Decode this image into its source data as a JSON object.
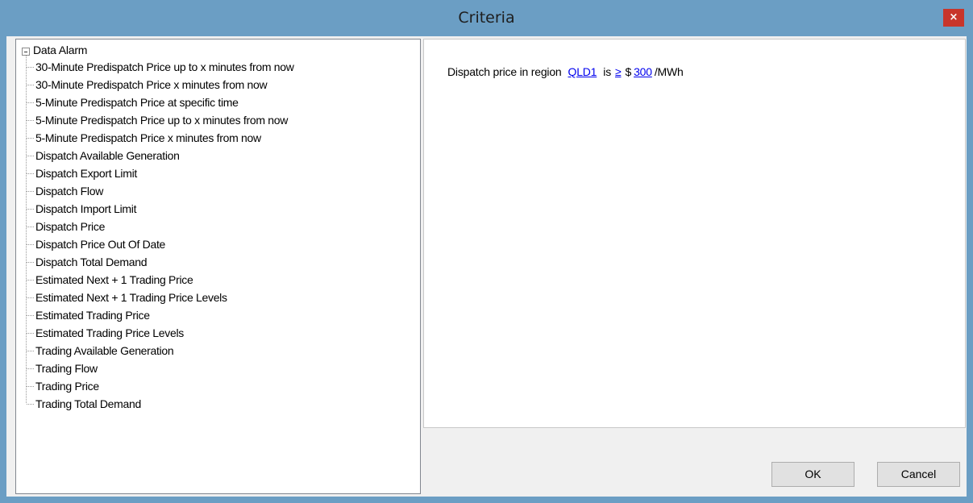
{
  "window": {
    "title": "Criteria",
    "close_label": "×"
  },
  "tree": {
    "root_label": "Data Alarm",
    "items": [
      {
        "label": "30-Minute Predispatch Price up to x minutes from now"
      },
      {
        "label": "30-Minute Predispatch Price x minutes from now"
      },
      {
        "label": "5-Minute Predispatch Price at specific time"
      },
      {
        "label": "5-Minute Predispatch Price up to x minutes from now"
      },
      {
        "label": "5-Minute Predispatch Price x minutes from now"
      },
      {
        "label": "Dispatch Available Generation"
      },
      {
        "label": "Dispatch Export Limit"
      },
      {
        "label": "Dispatch Flow"
      },
      {
        "label": "Dispatch Import Limit"
      },
      {
        "label": "Dispatch Price"
      },
      {
        "label": "Dispatch Price Out Of Date"
      },
      {
        "label": "Dispatch Total Demand"
      },
      {
        "label": "Estimated Next + 1 Trading Price"
      },
      {
        "label": "Estimated Next + 1 Trading Price Levels"
      },
      {
        "label": "Estimated Trading Price"
      },
      {
        "label": "Estimated Trading Price Levels"
      },
      {
        "label": "Trading Available Generation"
      },
      {
        "label": "Trading Flow"
      },
      {
        "label": "Trading Price"
      },
      {
        "label": "Trading Total Demand"
      }
    ]
  },
  "criteria": {
    "prefix": "Dispatch price in region",
    "region": "QLD1",
    "is_text": "is",
    "operator": "≥",
    "currency": "$",
    "value": "300",
    "unit": "/MWh"
  },
  "buttons": {
    "ok_label": "OK",
    "cancel_label": "Cancel"
  },
  "colors": {
    "window_frame": "#6b9ec4",
    "close_button": "#c8352b",
    "link": "#0000ee"
  }
}
